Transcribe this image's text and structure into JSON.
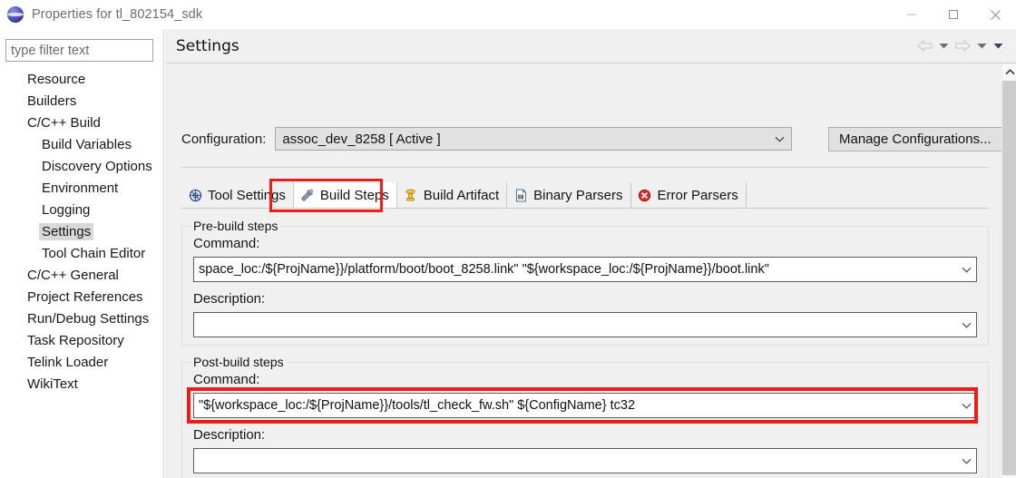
{
  "window": {
    "title": "Properties for tl_802154_sdk",
    "icon": "eclipse-globe-icon",
    "controls": {
      "minimize": "minimize-icon",
      "maximize": "maximize-icon",
      "close": "close-icon"
    }
  },
  "sidebar": {
    "filter_placeholder": "type filter text",
    "filter_value": "",
    "items": [
      {
        "label": "Resource",
        "level": 0,
        "selected": false
      },
      {
        "label": "Builders",
        "level": 0,
        "selected": false
      },
      {
        "label": "C/C++ Build",
        "level": 0,
        "selected": false
      },
      {
        "label": "Build Variables",
        "level": 1,
        "selected": false
      },
      {
        "label": "Discovery Options",
        "level": 1,
        "selected": false
      },
      {
        "label": "Environment",
        "level": 1,
        "selected": false
      },
      {
        "label": "Logging",
        "level": 1,
        "selected": false
      },
      {
        "label": "Settings",
        "level": 1,
        "selected": true
      },
      {
        "label": "Tool Chain Editor",
        "level": 1,
        "selected": false
      },
      {
        "label": "C/C++ General",
        "level": 0,
        "selected": false
      },
      {
        "label": "Project References",
        "level": 0,
        "selected": false
      },
      {
        "label": "Run/Debug Settings",
        "level": 0,
        "selected": false
      },
      {
        "label": "Task Repository",
        "level": 0,
        "selected": false
      },
      {
        "label": "Telink Loader",
        "level": 0,
        "selected": false
      },
      {
        "label": "WikiText",
        "level": 0,
        "selected": false
      }
    ]
  },
  "pane": {
    "title": "Settings",
    "nav": {
      "back": "back-arrow-icon",
      "back_dropdown": "chevron-down-icon",
      "forward": "forward-arrow-icon",
      "forward_dropdown": "chevron-down-icon",
      "menu_dropdown": "chevron-down-icon"
    }
  },
  "configuration": {
    "label": "Configuration:",
    "value": "assoc_dev_8258  [ Active ]",
    "manage_button": "Manage Configurations..."
  },
  "tabs": [
    {
      "label": "Tool Settings",
      "icon": "tool-settings-icon",
      "active": false,
      "highlighted": false
    },
    {
      "label": "Build Steps",
      "icon": "build-steps-icon",
      "active": true,
      "highlighted": true
    },
    {
      "label": "Build Artifact",
      "icon": "build-artifact-icon",
      "active": false,
      "highlighted": false
    },
    {
      "label": "Binary Parsers",
      "icon": "binary-parsers-icon",
      "active": false,
      "highlighted": false
    },
    {
      "label": "Error Parsers",
      "icon": "error-parsers-icon",
      "active": false,
      "highlighted": false
    }
  ],
  "prebuild": {
    "group_title": "Pre-build steps",
    "command_label": "Command:",
    "command_value": "space_loc:/${ProjName}}/platform/boot/boot_8258.link\" \"${workspace_loc:/${ProjName}}/boot.link\"",
    "description_label": "Description:",
    "description_value": ""
  },
  "postbuild": {
    "group_title": "Post-build steps",
    "command_label": "Command:",
    "command_value": "\"${workspace_loc:/${ProjName}}/tools/tl_check_fw.sh\" ${ConfigName} tc32",
    "description_label": "Description:",
    "description_value": ""
  },
  "annotations": {
    "highlight_color": "#ee1b17",
    "highlights": [
      {
        "target": "tab-build-steps"
      },
      {
        "target": "postbuild-command-combo"
      }
    ]
  },
  "scrollbar": {
    "up_arrow": "chevron-up-icon",
    "position": "top"
  }
}
